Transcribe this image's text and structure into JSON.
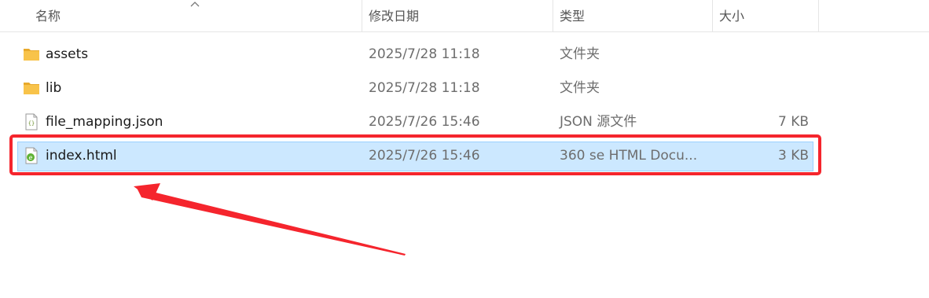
{
  "columns": {
    "name": "名称",
    "date": "修改日期",
    "type": "类型",
    "size": "大小"
  },
  "files": [
    {
      "name": "assets",
      "date": "2025/7/28 11:18",
      "type": "文件夹",
      "size": "",
      "icon": "folder-icon"
    },
    {
      "name": "lib",
      "date": "2025/7/28 11:18",
      "type": "文件夹",
      "size": "",
      "icon": "folder-icon"
    },
    {
      "name": "file_mapping.json",
      "date": "2025/7/26 15:46",
      "type": "JSON 源文件",
      "size": "7 KB",
      "icon": "json-file-icon"
    },
    {
      "name": "index.html",
      "date": "2025/7/26 15:46",
      "type": "360 se HTML Docu...",
      "size": "3 KB",
      "icon": "html-file-icon",
      "selected": true
    }
  ],
  "colors": {
    "selection_bg": "#cce8ff",
    "selection_border": "#99d1ff",
    "annotation_red": "#f5252d",
    "folder_yellow": "#f8c34a"
  }
}
